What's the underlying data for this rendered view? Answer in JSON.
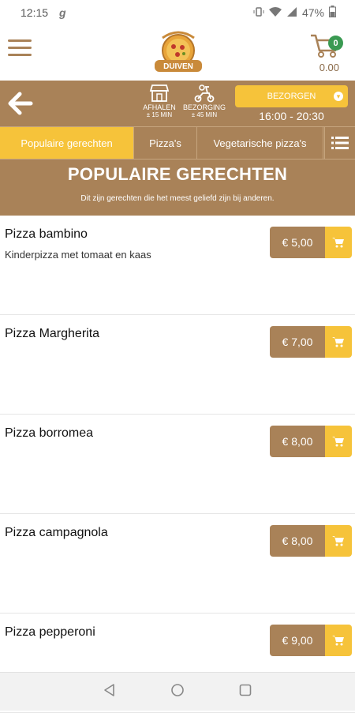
{
  "status_bar": {
    "time": "12:15",
    "app_glyph": "g",
    "battery": "47%"
  },
  "cart": {
    "count": "0",
    "total": "0.00"
  },
  "order_modes": {
    "pickup_label": "AFHALEN",
    "pickup_time": "± 15 MIN",
    "delivery_label": "BEZORGING",
    "delivery_time": "± 45 MIN"
  },
  "delivery_select": {
    "value": "BEZORGEN",
    "time_range": "16:00 - 20:30"
  },
  "tabs": [
    {
      "label": "Populaire gerechten"
    },
    {
      "label": "Pizza's"
    },
    {
      "label": "Vegetarische pizza's"
    }
  ],
  "section": {
    "title": "POPULAIRE GERECHTEN",
    "subtitle": "Dit zijn gerechten die het meest geliefd zijn bij anderen."
  },
  "items": [
    {
      "name": "Pizza bambino",
      "desc": "Kinderpizza met tomaat en kaas",
      "price": "€ 5,00"
    },
    {
      "name": "Pizza Margherita",
      "desc": "",
      "price": "€ 7,00"
    },
    {
      "name": "Pizza borromea",
      "desc": "",
      "price": "€ 8,00"
    },
    {
      "name": "Pizza campagnola",
      "desc": "",
      "price": "€ 8,00"
    },
    {
      "name": "Pizza pepperoni",
      "desc": "",
      "price": "€ 9,00"
    }
  ],
  "colors": {
    "brown": "#a98258",
    "yellow": "#f6c33a",
    "green": "#3a9a52"
  },
  "icons": [
    "menu-icon",
    "pizza-logo-icon",
    "cart-icon",
    "back-arrow-icon",
    "shop-icon",
    "scooter-icon",
    "chevron-down-icon",
    "list-icon",
    "cart-add-icon",
    "nav-back-icon",
    "nav-home-icon",
    "nav-recents-icon"
  ]
}
